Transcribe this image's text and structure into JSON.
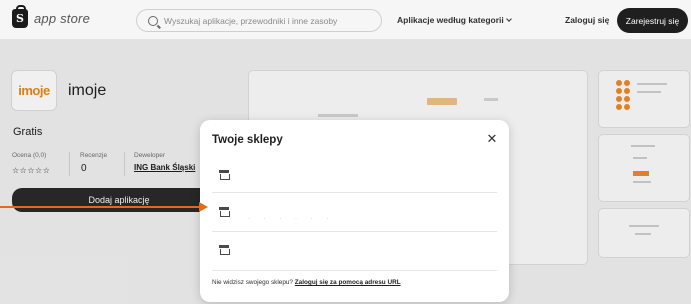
{
  "header": {
    "logo_text": "app store",
    "search_placeholder": "Wyszukaj aplikacje, przewodniki i inne zasoby",
    "categories_label": "Aplikacje według kategorii",
    "login_label": "Zaloguj się",
    "register_label": "Zarejestruj się"
  },
  "app": {
    "icon_text": "imoje",
    "name": "imoje",
    "price": "Gratis",
    "rating_label": "Ocena (0,0)",
    "rating_stars": "☆☆☆☆☆",
    "reviews_label": "Recenzje",
    "reviews_count": "0",
    "developer_label": "Deweloper",
    "developer_name": "ING Bank Śląski",
    "install_label": "Dodaj aplikację"
  },
  "modal": {
    "title": "Twoje sklepy",
    "close_symbol": "✕",
    "stores": [
      {
        "name": ""
      },
      {
        "name": "· · · · · ·"
      },
      {
        "name": ""
      }
    ],
    "footer_text": "Nie widzisz swojego sklepu?",
    "footer_link": "Zaloguj się za pomocą adresu URL"
  },
  "colors": {
    "accent_orange": "#e46a1a",
    "dark_button": "#1f1f1f",
    "brand_imoje": "#e8871a"
  }
}
